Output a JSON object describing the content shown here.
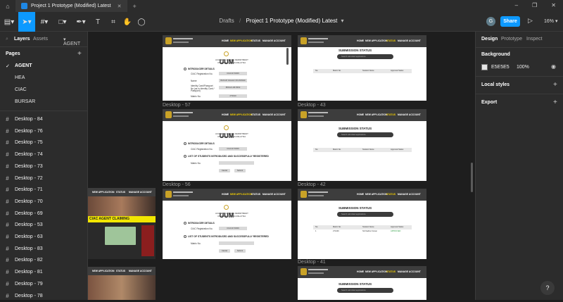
{
  "titlebar": {
    "tab_title": "Project 1 Prototype (Modified) Latest",
    "new_tab": "+"
  },
  "toolbar": {
    "breadcrumb_project": "Drafts",
    "breadcrumb_sep": "/",
    "file_name": "Project 1 Prototype (Modified) Latest",
    "avatar_initial": "G",
    "share_label": "Share",
    "zoom": "16%"
  },
  "left_panel": {
    "tab_layers": "Layers",
    "tab_assets": "Assets",
    "page_selector": "AGENT",
    "pages_heading": "Pages",
    "pages": [
      "AGENT",
      "HEA",
      "CIAC",
      "BURSAR"
    ],
    "current_page": "AGENT",
    "layers": [
      "Desktop - 84",
      "Desktop - 76",
      "Desktop - 75",
      "Desktop - 74",
      "Desktop - 73",
      "Desktop - 72",
      "Desktop - 71",
      "Desktop - 70",
      "Desktop - 69",
      "Desktop - 53",
      "Desktop - 63",
      "Desktop - 83",
      "Desktop - 82",
      "Desktop - 81",
      "Desktop - 79",
      "Desktop - 78"
    ]
  },
  "canvas": {
    "frame_labels": {
      "d57": "Desktop - 57",
      "d43": "Desktop - 43",
      "d56": "Desktop - 56",
      "d42": "Desktop - 42",
      "d41": "Desktop - 41"
    },
    "nav": {
      "home": "HOME",
      "new_application": "NEW APPLICATION",
      "status": "STATUS",
      "manage_account": "MANAGE ACCOUNT"
    },
    "uum_logo": "UUM",
    "uum_sub1": "ACADEMIC AFFAIRS DEPARTMENT",
    "uum_sub2": "UNIVERSITI UTARA MALAYSIA",
    "form": {
      "introducer": "INTRODUCER DETAILS",
      "ciac_reg": "CIAC Registration No.",
      "ciac_reg_value": "CIAC/27/2006",
      "name": "Name",
      "name_value": "BAKAR SALEH OR ANWAR",
      "identity": "Identity Card/Passport No (as in Identity Card / Passport)",
      "identity_value": "880121-08-5663",
      "matric": "Matric No.",
      "matric_value": "279190",
      "list_students": "LIST OF STUDENTS INTRODUCED AND SUCCESSFULLY REGISTERED",
      "matric_no": "Matric No.",
      "cancel": "Cancel",
      "submit": "Submit"
    },
    "status": {
      "title": "SUBMISSION STATUS",
      "search": "Search submitted applications",
      "col_no": "No.",
      "col_matric": "Matric No.",
      "col_name": "Student Name",
      "col_approval": "Approval Status",
      "row_no": "1",
      "row_matric": "271346",
      "row_name": "Siti Nadira Osman",
      "row_status": "APPROVED"
    },
    "ciac_banner": "CIAC AGENT CLAIMING"
  },
  "right_panel": {
    "tab_design": "Design",
    "tab_prototype": "Prototype",
    "tab_inspect": "Inspect",
    "background_heading": "Background",
    "bg_hex": "E5E5E5",
    "bg_opacity": "100%",
    "local_styles": "Local styles",
    "export": "Export"
  },
  "help": "?",
  "colors": {
    "accent": "#0d99ff",
    "canvas_bg": "#1e1e1e",
    "panel_bg": "#2c2c2c",
    "swatch": "#e5e5e5"
  }
}
